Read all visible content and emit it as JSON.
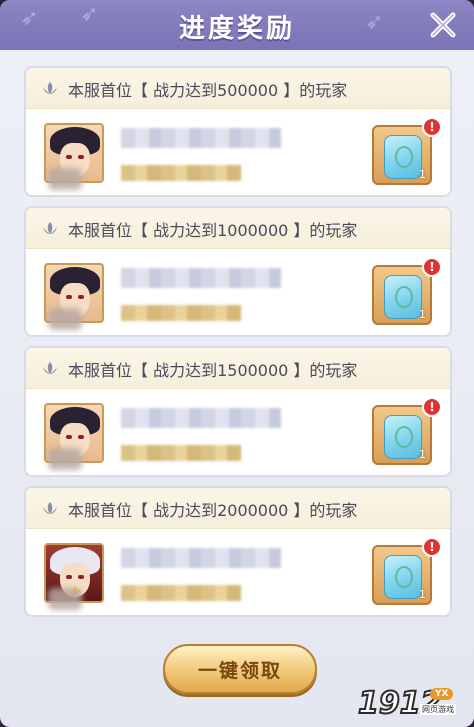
{
  "header": {
    "title": "进度奖励"
  },
  "rewards": [
    {
      "requirement": "本服首位【 战力达到500000 】的玩家",
      "reward_count": "1",
      "badge": "!"
    },
    {
      "requirement": "本服首位【 战力达到1000000 】的玩家",
      "reward_count": "1",
      "badge": "!"
    },
    {
      "requirement": "本服首位【 战力达到1500000 】的玩家",
      "reward_count": "1",
      "badge": "!"
    },
    {
      "requirement": "本服首位【 战力达到2000000 】的玩家",
      "reward_count": "1",
      "badge": "!"
    }
  ],
  "actions": {
    "claim_all": "一键领取"
  },
  "watermark": {
    "number": "1912",
    "tag": "YX",
    "sub": "网页游戏"
  },
  "colors": {
    "header": "#8d86c4",
    "badge": "#e23333",
    "button": "#f3cf83"
  }
}
